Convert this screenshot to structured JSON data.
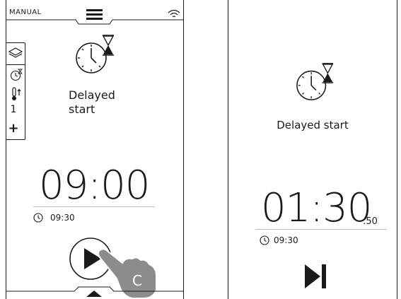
{
  "left_screen": {
    "mode_label": "MANUAL",
    "function_name_line1": "Delayed",
    "function_name_line2": "start",
    "side_panel": {
      "level": "1",
      "plus": "+"
    },
    "start_time": "09:00",
    "end_time": "09:30",
    "hand_label": "C"
  },
  "right_screen": {
    "function_name": "Delayed start",
    "countdown_main": "01:30",
    "countdown_seconds": ":50",
    "end_time": "09:30"
  },
  "icons": {
    "menu": "menu-icon",
    "wifi": "wifi-icon",
    "layers": "layers-icon",
    "timer": "timer-icon",
    "temperature": "thermometer-icon",
    "delayed_start": "clock-hourglass-icon",
    "clock": "clock-icon",
    "play": "play-icon",
    "skip": "skip-icon"
  },
  "colors": {
    "ink": "#1a1a1a",
    "rule": "#bbbbbb",
    "hand_fill": "#8c8c8c"
  }
}
